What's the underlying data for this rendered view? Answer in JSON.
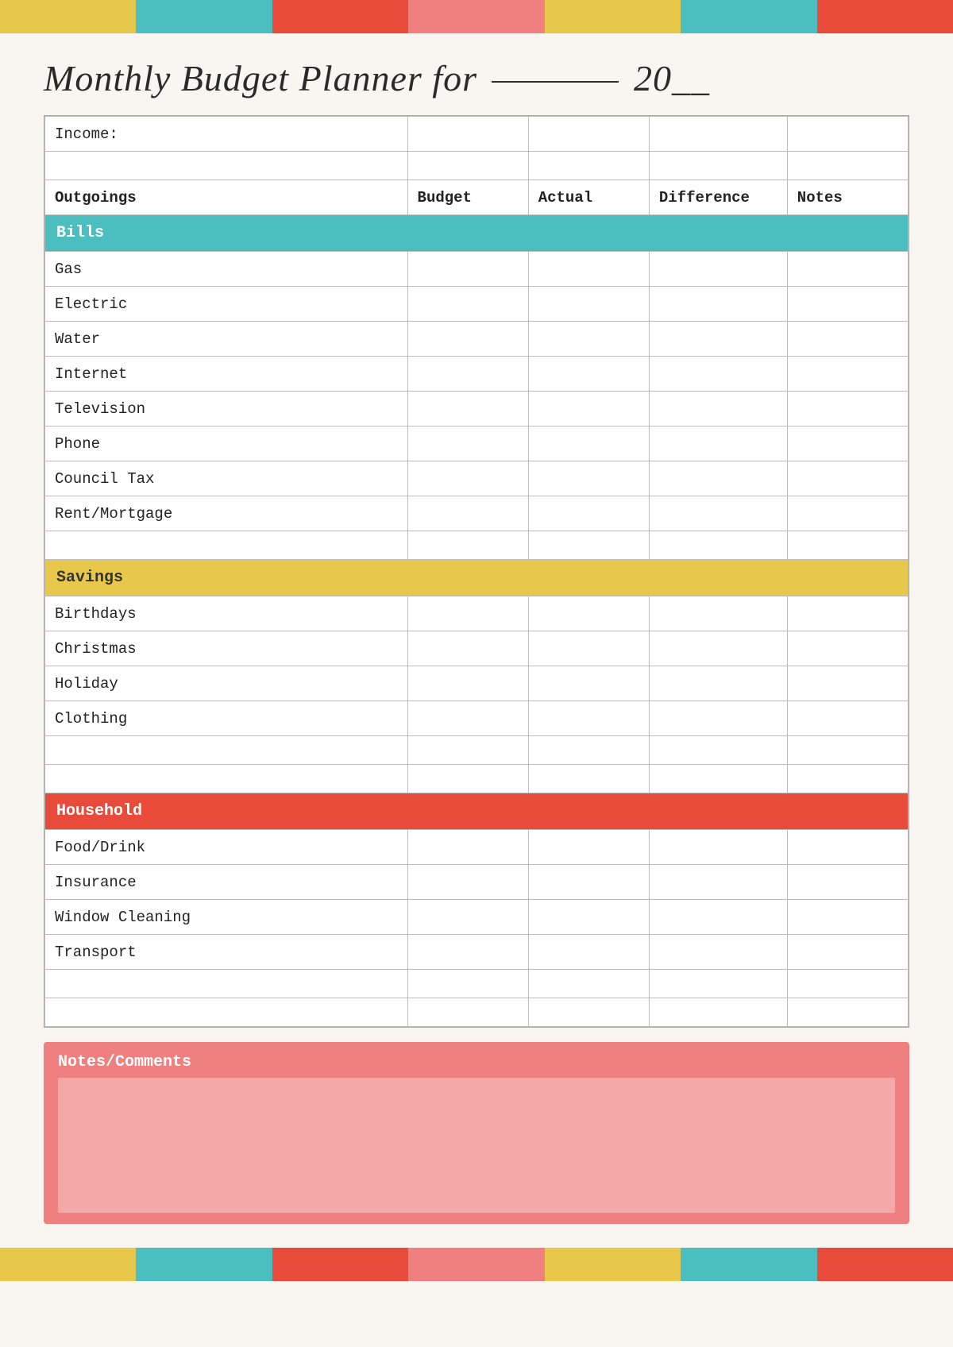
{
  "topBar": {
    "blocks": [
      "#e8c84a",
      "#4bbfbf",
      "#e84b3a",
      "#f07f7f",
      "#e8c84a",
      "#4bbfbf",
      "#e84b3a"
    ]
  },
  "title": {
    "prefix": "Monthly Budget Planner for",
    "line": "__________",
    "year": "20__"
  },
  "table": {
    "incomeLabel": "Income:",
    "headers": {
      "outgoings": "Outgoings",
      "budget": "Budget",
      "actual": "Actual",
      "difference": "Difference",
      "notes": "Notes"
    },
    "sections": [
      {
        "name": "Bills",
        "color": "bills-header",
        "rows": [
          "Gas",
          "Electric",
          "Water",
          "Internet",
          "Television",
          "Phone",
          "Council Tax",
          "Rent/Mortgage"
        ]
      },
      {
        "name": "Savings",
        "color": "savings-header",
        "rows": [
          "Birthdays",
          "Christmas",
          "Holiday",
          "Clothing",
          "",
          ""
        ]
      },
      {
        "name": "Household",
        "color": "household-header",
        "rows": [
          "Food/Drink",
          "Insurance",
          "Window Cleaning",
          "Transport",
          "",
          ""
        ]
      }
    ]
  },
  "notesSection": {
    "label": "Notes/Comments"
  },
  "bottomBar": {
    "blocks": [
      "#e8c84a",
      "#4bbfbf",
      "#e84b3a",
      "#f07f7f",
      "#e8c84a",
      "#4bbfbf",
      "#e84b3a"
    ]
  }
}
